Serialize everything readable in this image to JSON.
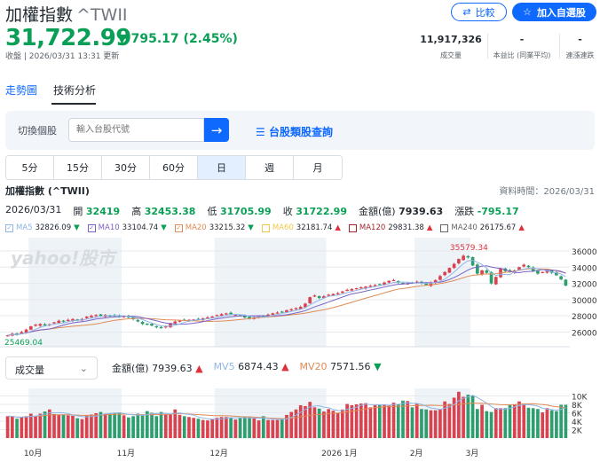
{
  "header": {
    "title": "加權指數",
    "symbol": "^TWII",
    "price": "31,722.99",
    "change": "▼ 795.17 (2.45%)",
    "updated": "收盤 | 2026/03/31 13:31 更新",
    "compare_label": "比較",
    "add_watch_label": "加入自選股"
  },
  "stats": [
    {
      "value": "11,917,326",
      "label": "成交量"
    },
    {
      "value": "-",
      "label": "本益比 (同業平均)"
    },
    {
      "value": "-",
      "label": "連漲連跌"
    }
  ],
  "tabs": [
    {
      "label": "走勢圖"
    },
    {
      "label": "技術分析"
    }
  ],
  "search": {
    "label": "切換個股",
    "placeholder": "輸入台股代號",
    "link": "台股類股查詢"
  },
  "intervals": [
    "5分",
    "15分",
    "30分",
    "60分",
    "日",
    "週",
    "月"
  ],
  "info": {
    "name": "加權指數 (^TWII)",
    "data_time": "資料時間：2026/03/31",
    "date": "2026/03/31",
    "open_l": "開",
    "open": "32419",
    "high_l": "高",
    "high": "32453.38",
    "low_l": "低",
    "low": "31705.99",
    "close_l": "收",
    "close": "31722.99",
    "amt_l": "金額(億)",
    "amt": "7939.63",
    "chg_l": "漲跌",
    "chg": "-795.17"
  },
  "ma": [
    {
      "name": "MA5",
      "value": "32826.09",
      "dir": "▼",
      "color": "#8fb6e6"
    },
    {
      "name": "MA10",
      "value": "33104.74",
      "dir": "▼",
      "color": "#7b62c6"
    },
    {
      "name": "MA20",
      "value": "33215.32",
      "dir": "▼",
      "color": "#e08a55"
    },
    {
      "name": "MA60",
      "value": "32181.74",
      "dir": "▲",
      "color": "#f0c84a"
    },
    {
      "name": "MA120",
      "value": "29831.38",
      "dir": "▲",
      "color": "#a0282c"
    },
    {
      "name": "MA240",
      "value": "26175.67",
      "dir": "▲",
      "color": "#666666"
    }
  ],
  "volume": {
    "select": "成交量",
    "amt_l": "金額(億)",
    "amt": "7939.63",
    "amt_dir": "▲",
    "mv5_l": "MV5",
    "mv5": "6874.43",
    "mv5_dir": "▲",
    "mv20_l": "MV20",
    "mv20": "7571.56",
    "mv20_dir": "▼"
  },
  "watermark": "yahoo!股市",
  "chart_data": {
    "type": "candlestick",
    "colors": {
      "up": "#d9424e",
      "down": "#2e9e6e"
    },
    "price_ticks": [
      26000,
      28000,
      30000,
      32000,
      34000,
      36000
    ],
    "price_ylim": [
      24300,
      37200
    ],
    "volume_ticks": [
      "2K",
      "4K",
      "6K",
      "8K",
      "10K"
    ],
    "volume_tick_values": [
      2,
      4,
      6,
      8,
      10
    ],
    "volume_ylim": [
      0,
      11.8
    ],
    "max_label": "35579.34",
    "min_label": "25469.04",
    "month_labels": [
      {
        "label": "10月",
        "idx": 5
      },
      {
        "label": "11月",
        "idx": 25
      },
      {
        "label": "12月",
        "idx": 45
      },
      {
        "label": "2026 1月",
        "idx": 69
      },
      {
        "label": "2月",
        "idx": 88
      },
      {
        "label": "3月",
        "idx": 100
      }
    ],
    "closes": [
      25600,
      25800,
      25700,
      26000,
      26300,
      26700,
      26900,
      27000,
      26800,
      26950,
      27200,
      27400,
      27300,
      27500,
      27600,
      27400,
      27600,
      27900,
      28000,
      28100,
      28000,
      28100,
      28050,
      27950,
      27900,
      28000,
      27800,
      27600,
      27300,
      27000,
      26900,
      26800,
      26600,
      26500,
      26700,
      27100,
      27300,
      27400,
      27450,
      27500,
      27550,
      27600,
      27700,
      27800,
      27900,
      28100,
      28200,
      28300,
      28200,
      28100,
      28000,
      27800,
      27700,
      27800,
      27950,
      28000,
      28150,
      28300,
      28400,
      28500,
      28700,
      28800,
      28950,
      29100,
      29500,
      30300,
      30500,
      30200,
      30400,
      30600,
      30700,
      30800,
      31000,
      31200,
      31300,
      31400,
      31500,
      31600,
      31700,
      31800,
      31900,
      32100,
      32300,
      32400,
      32100,
      31900,
      32000,
      32100,
      32200,
      32000,
      31800,
      32100,
      32400,
      32900,
      33400,
      33900,
      34400,
      35000,
      35400,
      35200,
      34200,
      33200,
      33600,
      33300,
      32000,
      32800,
      33800,
      33500,
      33400,
      33600,
      34000,
      34300,
      34000,
      33500,
      33200,
      33400,
      33600,
      33300,
      33000,
      32500,
      31723
    ],
    "volumes_k": [
      5.2,
      5.1,
      4.6,
      5.0,
      5.2,
      5.8,
      5.3,
      5.8,
      6.3,
      6.8,
      5.7,
      5.5,
      5.6,
      5.4,
      5.3,
      4.7,
      4.5,
      5.4,
      5.6,
      5.9,
      6.2,
      5.8,
      5.8,
      6.0,
      6.1,
      5.4,
      4.9,
      5.2,
      5.8,
      5.6,
      6.4,
      6.0,
      5.2,
      6.2,
      5.6,
      5.6,
      6.8,
      5.5,
      5.2,
      5.0,
      4.8,
      4.6,
      4.3,
      4.2,
      4.5,
      4.8,
      5.0,
      5.0,
      4.9,
      4.4,
      4.8,
      5.0,
      4.9,
      4.7,
      4.2,
      5.2,
      4.3,
      4.3,
      4.3,
      4.4,
      5.5,
      6.2,
      6.8,
      7.8,
      7.6,
      8.6,
      7.3,
      7.0,
      6.3,
      6.9,
      6.5,
      6.0,
      6.8,
      8.1,
      7.8,
      8.0,
      8.2,
      8.3,
      7.3,
      7.8,
      7.9,
      8.0,
      7.8,
      8.4,
      8.0,
      8.9,
      8.8,
      7.3,
      8.1,
      6.9,
      6.8,
      6.6,
      6.6,
      6.9,
      8.7,
      8.1,
      9.6,
      11.0,
      9.8,
      10.3,
      10.1,
      6.9,
      7.9,
      6.4,
      6.2,
      7.1,
      7.1,
      7.1,
      7.8,
      8.0,
      8.7,
      8.0,
      7.2,
      7.1,
      6.9,
      6.1,
      7.1,
      6.6,
      6.4,
      7.9,
      7.9
    ]
  }
}
